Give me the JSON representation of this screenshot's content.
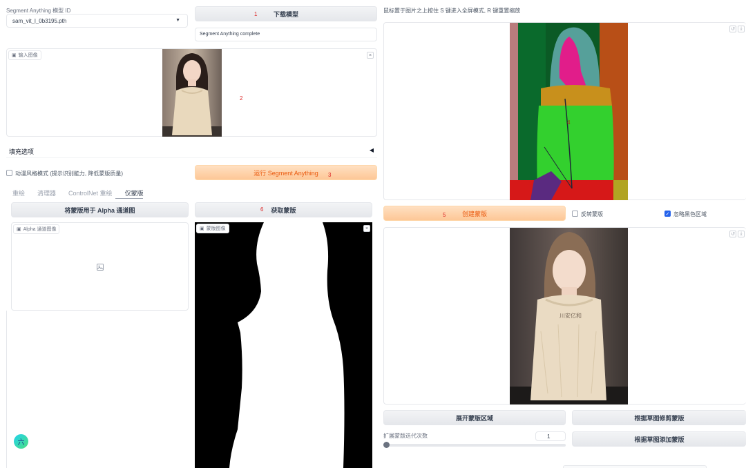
{
  "model": {
    "label": "Segment Anything 模型 ID",
    "selected": "sam_vit_l_0b3195.pth",
    "download_label": "下载模型",
    "status": "Segment Anything complete"
  },
  "input_image": {
    "tag": "输入图像"
  },
  "fill": {
    "label": "填充选项"
  },
  "anime": {
    "label": "动漫风格模式 (提示识别能力, 降低蒙版质量)"
  },
  "run_label": "运行 Segment Anything",
  "tabs": [
    "重绘",
    "清理器",
    "ControlNet 重绘",
    "仅蒙版"
  ],
  "alpha": {
    "button_label": "将蒙版用于 Alpha 通道图",
    "tag": "Alpha 通道图像"
  },
  "get_mask": {
    "button_label": "获取蒙版",
    "tag": "蒙版图像"
  },
  "hint": "鼠标置于图片之上按住 S 键进入全屏模式, R 键重置缩放",
  "create_mask_label": "创建蒙版",
  "invert": {
    "label": "反转蒙版",
    "checked": false
  },
  "ignore_black": {
    "label": "忽略黑色区域",
    "checked": true
  },
  "expand_label": "展开蒙版区域",
  "trim_label": "根据草图修剪蒙版",
  "add_label": "根据草图添加蒙版",
  "iterations": {
    "label": "扩展蒙版迭代次数",
    "value": "1"
  },
  "watermark": "川安亿和",
  "floating_icon": "六",
  "steps": [
    "1",
    "2",
    "3",
    "4",
    "5",
    "6"
  ],
  "colors": {
    "accent": "#ea580c",
    "primary_bg": "#fdc796",
    "checkbox": "#2563eb"
  }
}
